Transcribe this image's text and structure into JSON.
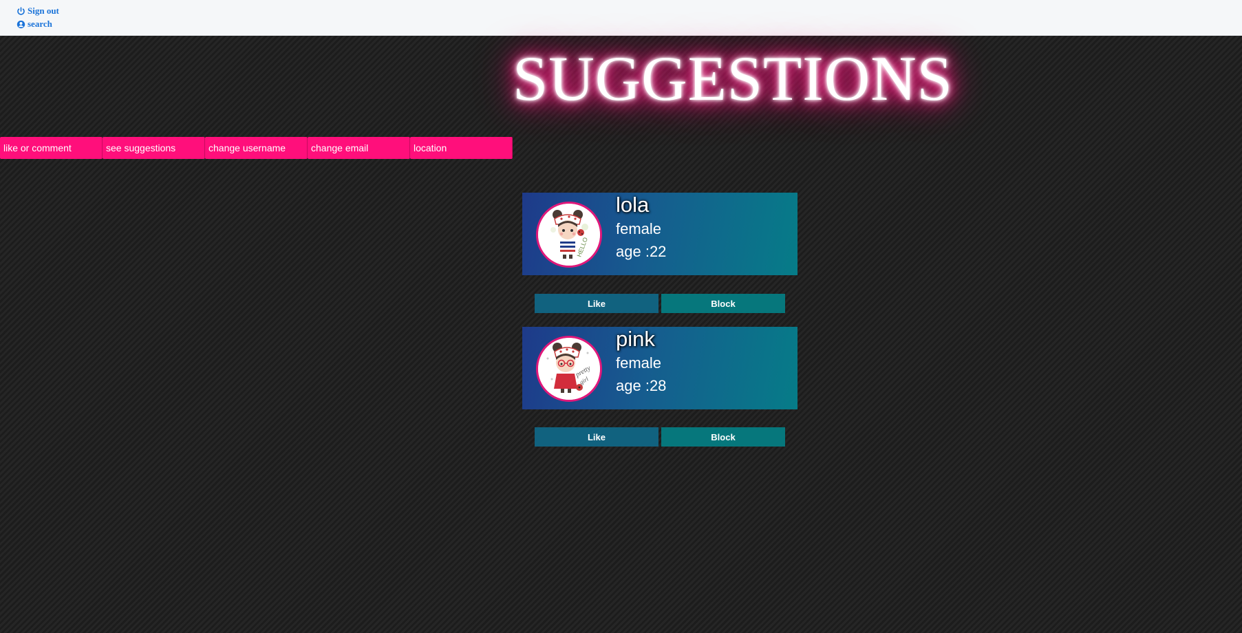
{
  "topbar": {
    "signout_label": "Sign out",
    "search_label": "search",
    "link_color": "#1a73d9"
  },
  "title": "SUGGESTIONS",
  "nav": {
    "items": [
      {
        "label": "like or comment"
      },
      {
        "label": "see suggestions"
      },
      {
        "label": "change username"
      },
      {
        "label": "change email"
      },
      {
        "label": "location"
      }
    ],
    "color": "#ff0f7b"
  },
  "profiles": [
    {
      "name": "lola",
      "gender": "female",
      "age_label": "age :",
      "age": "22",
      "avatar": "cartoon-girl-hello-avatar",
      "like_label": "Like",
      "block_label": "Block"
    },
    {
      "name": "pink",
      "gender": "female",
      "age_label": "age :",
      "age": "28",
      "avatar": "cartoon-girl-pretty-girl-avatar",
      "like_label": "Like",
      "block_label": "Block"
    }
  ],
  "colors": {
    "accent": "#ff0f7b",
    "like_button": "#11627f",
    "block_button": "#06777c",
    "card_gradient_start": "#1e3a8a",
    "card_gradient_end": "#067c88"
  }
}
